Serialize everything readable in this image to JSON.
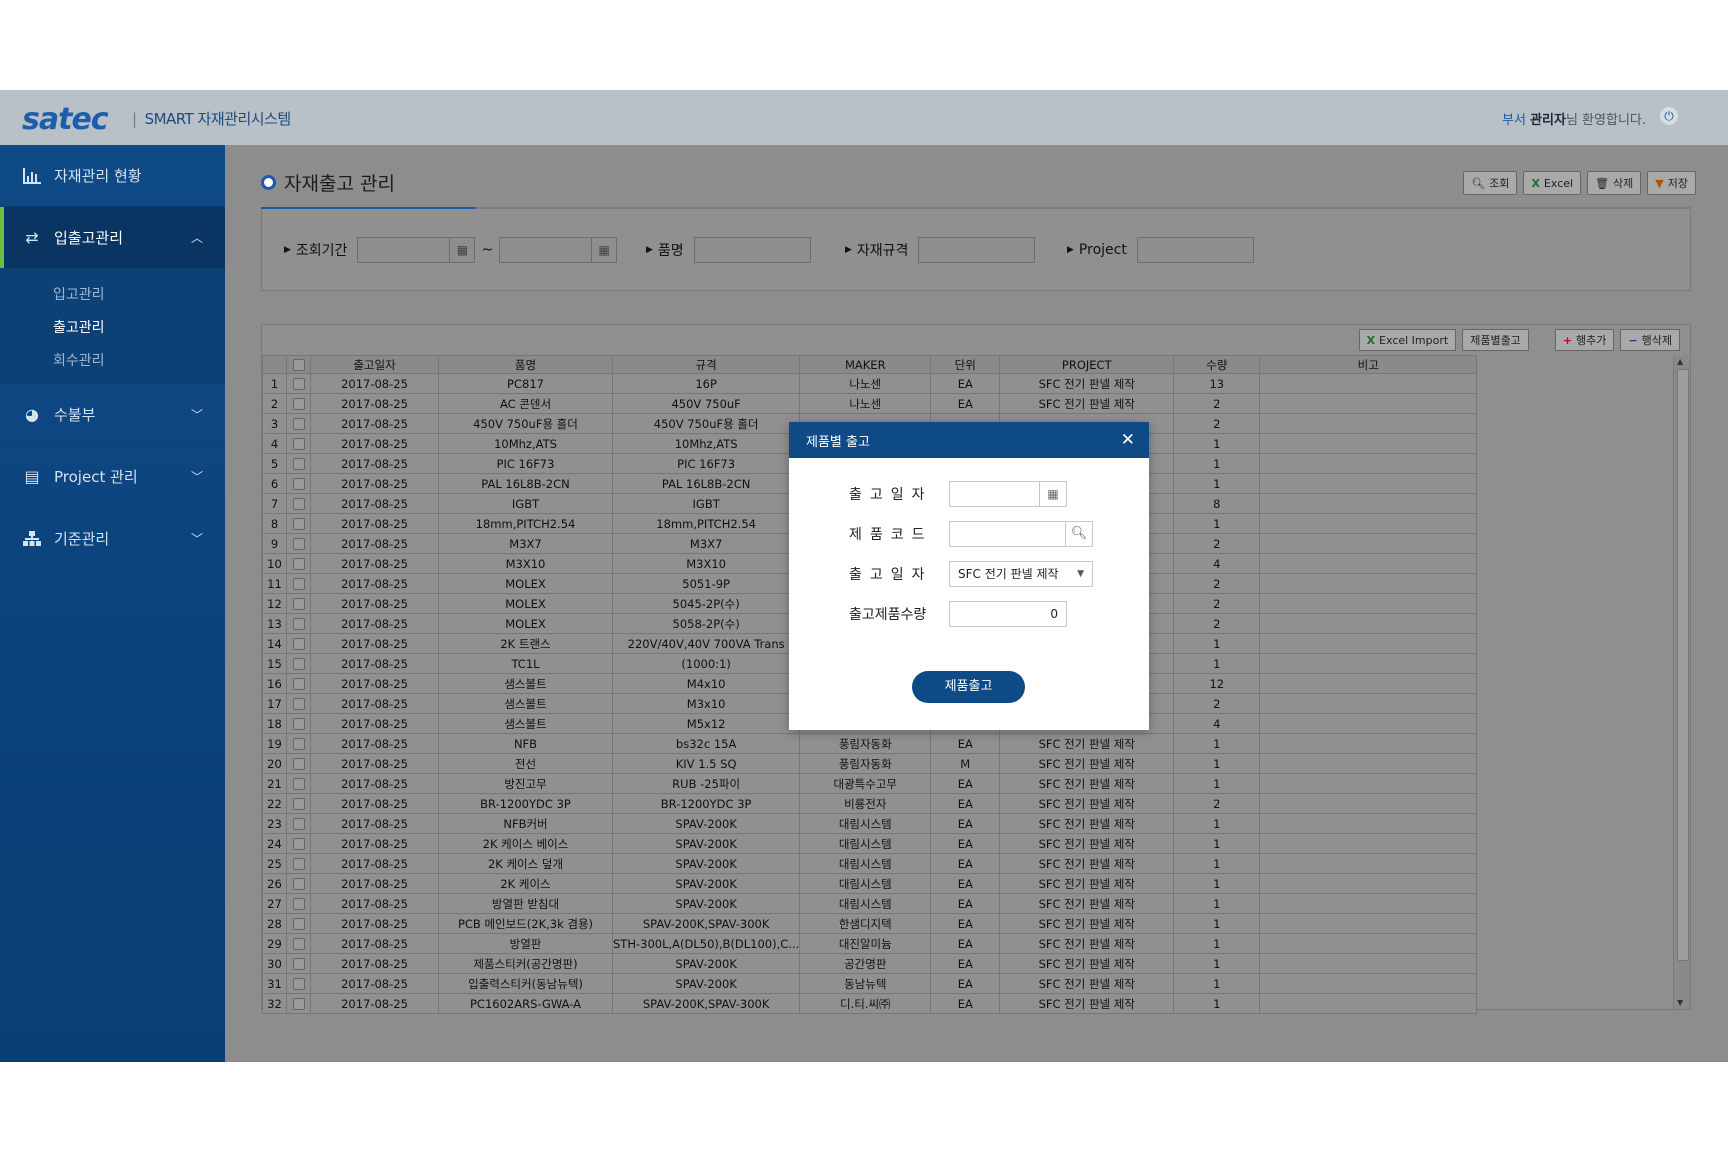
{
  "header": {
    "logo": "satec",
    "system_name": "SMART 자재관리시스템",
    "welcome_dept": "부서",
    "welcome_user": "관리자",
    "welcome_suffix": "님 환영합니다."
  },
  "sidebar": {
    "items": [
      {
        "label": "자재관리 현황",
        "icon": "bar-chart-icon"
      },
      {
        "label": "입출고관리",
        "icon": "swap-arrows-icon"
      },
      {
        "label": "수불부",
        "icon": "pie-chart-icon"
      },
      {
        "label": "Project 관리",
        "icon": "document-icon"
      },
      {
        "label": "기준관리",
        "icon": "hierarchy-icon"
      }
    ],
    "subitems": [
      "입고관리",
      "출고관리",
      "회수관리"
    ]
  },
  "page": {
    "title": "자재출고 관리",
    "toolbar": {
      "search": "조회",
      "excel": "Excel",
      "delete": "삭제",
      "save": "저장"
    }
  },
  "search": {
    "period_label": "조회기간",
    "range_sep": "~",
    "item_label": "품명",
    "spec_label": "자재규격",
    "project_label": "Project"
  },
  "grid": {
    "tools": {
      "excel_import": "Excel Import",
      "product_out": "제품별출고",
      "add_row": "행추가",
      "delete_row": "행삭제"
    },
    "columns": [
      "출고일자",
      "품명",
      "규격",
      "MAKER",
      "단위",
      "PROJECT",
      "수량",
      "비고"
    ],
    "rows": [
      [
        "1",
        "2017-08-25",
        "PC817",
        "16P",
        "나노센",
        "EA",
        "SFC 전기 판넬 제작",
        "13"
      ],
      [
        "2",
        "2017-08-25",
        "AC 콘덴서",
        "450V 750uF",
        "나노센",
        "EA",
        "SFC 전기 판넬 제작",
        "2"
      ],
      [
        "3",
        "2017-08-25",
        "450V 750uF용 홀더",
        "450V 750uF용 홀더",
        "",
        "",
        "",
        "2"
      ],
      [
        "4",
        "2017-08-25",
        "10Mhz,ATS",
        "10Mhz,ATS",
        "",
        "",
        "",
        "1"
      ],
      [
        "5",
        "2017-08-25",
        "PIC 16F73",
        "PIC 16F73",
        "",
        "",
        "",
        "1"
      ],
      [
        "6",
        "2017-08-25",
        "PAL 16L8B-2CN",
        "PAL 16L8B-2CN",
        "",
        "",
        "",
        "1"
      ],
      [
        "7",
        "2017-08-25",
        "IGBT",
        "IGBT",
        "",
        "",
        "",
        "8"
      ],
      [
        "8",
        "2017-08-25",
        "18mm,PITCH2.54",
        "18mm,PITCH2.54",
        "",
        "",
        "",
        "1"
      ],
      [
        "9",
        "2017-08-25",
        "M3X7",
        "M3X7",
        "",
        "",
        "",
        "2"
      ],
      [
        "10",
        "2017-08-25",
        "M3X10",
        "M3X10",
        "",
        "",
        "",
        "4"
      ],
      [
        "11",
        "2017-08-25",
        "MOLEX",
        "5051-9P",
        "",
        "",
        "",
        "2"
      ],
      [
        "12",
        "2017-08-25",
        "MOLEX",
        "5045-2P(수)",
        "",
        "",
        "",
        "2"
      ],
      [
        "13",
        "2017-08-25",
        "MOLEX",
        "5058-2P(수)",
        "",
        "",
        "",
        "2"
      ],
      [
        "14",
        "2017-08-25",
        "2K 트랜스",
        "220V/40V,40V 700VA Trans",
        "",
        "",
        "",
        "1"
      ],
      [
        "15",
        "2017-08-25",
        "TC1L",
        "(1000:1)",
        "",
        "",
        "",
        "1"
      ],
      [
        "16",
        "2017-08-25",
        "샘스볼트",
        "M4x10",
        "",
        "",
        "",
        "12"
      ],
      [
        "17",
        "2017-08-25",
        "샘스볼트",
        "M3x10",
        "",
        "",
        "",
        "2"
      ],
      [
        "18",
        "2017-08-25",
        "샘스볼트",
        "M5x12",
        "",
        "",
        "",
        "4"
      ],
      [
        "19",
        "2017-08-25",
        "NFB",
        "bs32c 15A",
        "풍림자동화",
        "EA",
        "SFC 전기 판넬 제작",
        "1"
      ],
      [
        "20",
        "2017-08-25",
        "전선",
        "KIV 1.5 SQ",
        "풍림자동화",
        "M",
        "SFC 전기 판넬 제작",
        "1"
      ],
      [
        "21",
        "2017-08-25",
        "방진고무",
        "RUB -25파이",
        "대광특수고무",
        "EA",
        "SFC 전기 판넬 제작",
        "1"
      ],
      [
        "22",
        "2017-08-25",
        "BR-1200YDC 3P",
        "BR-1200YDC 3P",
        "비룡전자",
        "EA",
        "SFC 전기 판넬 제작",
        "2"
      ],
      [
        "23",
        "2017-08-25",
        "NFB커버",
        "SPAV-200K",
        "대림시스템",
        "EA",
        "SFC 전기 판넬 제작",
        "1"
      ],
      [
        "24",
        "2017-08-25",
        "2K 케이스 베이스",
        "SPAV-200K",
        "대림시스템",
        "EA",
        "SFC 전기 판넬 제작",
        "1"
      ],
      [
        "25",
        "2017-08-25",
        "2K 케이스 덮개",
        "SPAV-200K",
        "대림시스템",
        "EA",
        "SFC 전기 판넬 제작",
        "1"
      ],
      [
        "26",
        "2017-08-25",
        "2K 케이스",
        "SPAV-200K",
        "대림시스템",
        "EA",
        "SFC 전기 판넬 제작",
        "1"
      ],
      [
        "27",
        "2017-08-25",
        "방열판 받침대",
        "SPAV-200K",
        "대림시스템",
        "EA",
        "SFC 전기 판넬 제작",
        "1"
      ],
      [
        "28",
        "2017-08-25",
        "PCB 메인보드(2K,3k 겸용)",
        "SPAV-200K,SPAV-300K",
        "한샘디지텍",
        "EA",
        "SFC 전기 판넬 제작",
        "1"
      ],
      [
        "29",
        "2017-08-25",
        "방열판",
        "STH-300L,A(DL50),B(DL100),C...",
        "대진알미늄",
        "EA",
        "SFC 전기 판넬 제작",
        "1"
      ],
      [
        "30",
        "2017-08-25",
        "제품스티커(공간명판)",
        "SPAV-200K",
        "공간명판",
        "EA",
        "SFC 전기 판넬 제작",
        "1"
      ],
      [
        "31",
        "2017-08-25",
        "입출력스티커(동남뉴텍)",
        "SPAV-200K",
        "동남뉴텍",
        "EA",
        "SFC 전기 판넬 제작",
        "1"
      ],
      [
        "32",
        "2017-08-25",
        "PC1602ARS-GWA-A",
        "SPAV-200K,SPAV-300K",
        "디.티.씨㈜",
        "EA",
        "SFC 전기 판넬 제작",
        "1"
      ]
    ]
  },
  "modal": {
    "title": "제품별 출고",
    "label_date": "출고일자",
    "label_code": "제품코드",
    "label_date2": "출고일자",
    "label_qty": "출고제품수량",
    "select_value": "SFC 전기 판넬 제작",
    "qty_value": "0",
    "submit": "제품출고"
  },
  "colors": {
    "brand": "#0e4a86",
    "accent_green": "#6ac13d",
    "overlay_gray": "#8d8d8d"
  }
}
